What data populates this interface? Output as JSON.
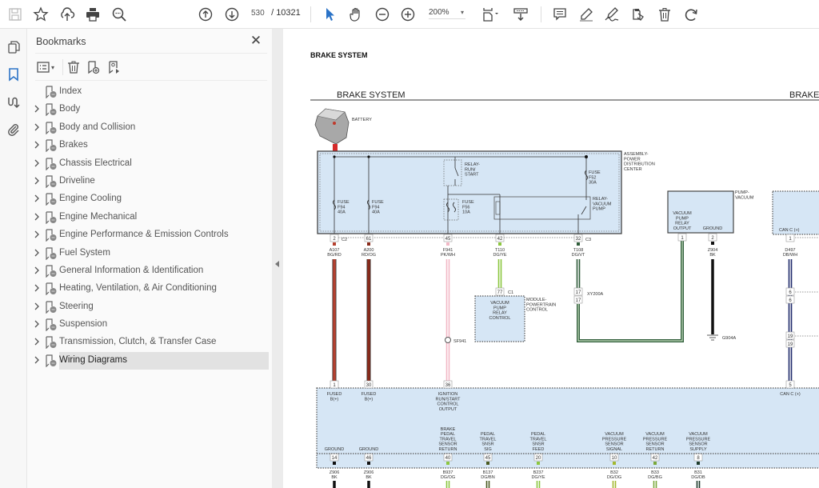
{
  "toolbar": {
    "buttons": [
      {
        "name": "save-icon",
        "label": "Save"
      },
      {
        "name": "star-icon",
        "label": "Bookmark"
      },
      {
        "name": "cloud-upload-icon",
        "label": "Upload"
      },
      {
        "name": "print-icon",
        "label": "Print"
      },
      {
        "name": "zoom-out-magnifier-icon",
        "label": "Find"
      },
      {
        "name": "arrow-up-circle-icon",
        "label": "Previous page"
      },
      {
        "name": "arrow-down-circle-icon",
        "label": "Next page"
      }
    ],
    "page_current": "530",
    "page_separator": "/",
    "page_total": "10321",
    "zoom_value": "200%",
    "tools": [
      "select-cursor-icon",
      "hand-icon",
      "zoom-out-icon",
      "zoom-in-icon",
      "fit-page-icon",
      "scroll-mode-icon",
      "comment-icon",
      "highlight-pen-icon",
      "sign-icon",
      "stamp-icon",
      "delete-icon",
      "rotate-icon"
    ]
  },
  "rail": {
    "items": [
      "pages-icon",
      "bookmark-icon",
      "articles-icon",
      "attachment-icon"
    ],
    "active": "bookmark-icon",
    "active_color": "#2b73c7"
  },
  "bookmarks": {
    "title": "Bookmarks",
    "items": [
      {
        "label": "Index",
        "expandable": false
      },
      {
        "label": "Body",
        "expandable": true
      },
      {
        "label": "Body and Collision",
        "expandable": true
      },
      {
        "label": "Brakes",
        "expandable": true
      },
      {
        "label": "Chassis Electrical",
        "expandable": true
      },
      {
        "label": "Driveline",
        "expandable": true
      },
      {
        "label": "Engine Cooling",
        "expandable": true
      },
      {
        "label": "Engine Mechanical",
        "expandable": true
      },
      {
        "label": "Engine Performance & Emission Controls",
        "expandable": true
      },
      {
        "label": "Fuel System",
        "expandable": true
      },
      {
        "label": "General Information & Identification",
        "expandable": true
      },
      {
        "label": "Heating, Ventilation, & Air Conditioning",
        "expandable": true
      },
      {
        "label": "Steering",
        "expandable": true
      },
      {
        "label": "Suspension",
        "expandable": true
      },
      {
        "label": "Transmission, Clutch, & Transfer Case",
        "expandable": true
      },
      {
        "label": "Wiring Diagrams",
        "expandable": true,
        "selected": true
      }
    ]
  },
  "document": {
    "page_heading": "BRAKE SYSTEM",
    "diagram_title": "BRAKE SYSTEM",
    "diagram_title_right": "BRAKE",
    "battery_label": "BATTERY",
    "pdc_label": [
      "ASSEMBLY-",
      "POWER",
      "DISTRIBUTION",
      "CENTER"
    ],
    "fuses": [
      {
        "lines": [
          "FUSE",
          "F94",
          "40A"
        ]
      },
      {
        "lines": [
          "FUSE",
          "F94",
          "40A"
        ]
      },
      {
        "lines": [
          "FUSE",
          "F56",
          "10A"
        ]
      },
      {
        "lines": [
          "FUSE",
          "F52",
          "30A"
        ]
      }
    ],
    "relay_run_start": [
      "RELAY-",
      "RUN/",
      "START"
    ],
    "relay_vacuum_pump": [
      "RELAY-",
      "VACUUM",
      "PUMP"
    ],
    "pdc_pins": [
      {
        "pin": "2",
        "conn": "C2",
        "circuit": "A107",
        "color": "BG/RD"
      },
      {
        "pin": "61",
        "conn": "",
        "circuit": "A200",
        "color": "RD/OG"
      },
      {
        "pin": "45",
        "conn": "",
        "circuit": "F941",
        "color": "PK/WH"
      },
      {
        "pin": "42",
        "conn": "",
        "circuit": "T110",
        "color": "DG/YE"
      },
      {
        "pin": "32",
        "conn": "C3",
        "circuit": "T108",
        "color": "DG/VT"
      }
    ],
    "pcm": {
      "pin": "77",
      "conn": "C1",
      "box_label": [
        "VACUUM",
        "PUMP",
        "RELAY",
        "CONTROL"
      ],
      "name": [
        "MODULE-",
        "POWERTRAIN",
        "CONTROL"
      ]
    },
    "splice": "SF941",
    "inline_connector": {
      "pin_top": "17",
      "pin_bottom": "17",
      "name": "XY200A"
    },
    "pump": {
      "name": [
        "PUMP-",
        "VACUUM"
      ],
      "output_label": [
        "VACUUM",
        "PUMP",
        "RELAY",
        "OUTPUT"
      ],
      "ground_label": "GROUND",
      "pin1": "1",
      "pin2": "2",
      "ground_circuit": "Z904",
      "ground_color": "BK",
      "ground_point": "G904A"
    },
    "can": {
      "label_top": "CAN C (+)",
      "pin_top": "1",
      "circuit": "D497",
      "color": "DB/WH",
      "pins_mid": [
        "6",
        "6",
        "19",
        "19"
      ],
      "pin_bottom": "5",
      "label_bottom": "CAN C (+)"
    },
    "lower_module_pins_top": [
      {
        "pin": "1",
        "label": [
          "FUSED",
          "B(+)"
        ]
      },
      {
        "pin": "30",
        "label": [
          "FUSED",
          "B(+)"
        ]
      },
      {
        "pin": "36",
        "label": [
          "IGNITION",
          "RUN/START",
          "CONTROL",
          "OUTPUT"
        ]
      }
    ],
    "lower_module_pins_bottom": [
      {
        "label": [
          "GROUND"
        ],
        "pin": "14",
        "circuit": "Z906",
        "color": "BK"
      },
      {
        "label": [
          "GROUND"
        ],
        "pin": "46",
        "circuit": "Z906",
        "color": "BK"
      },
      {
        "label": [
          "BRAKE",
          "PEDAL",
          "TRAVEL",
          "SENSOR",
          "RETURN"
        ],
        "pin": "40",
        "circuit": "B937",
        "color": "DG/OG"
      },
      {
        "label": [
          "PEDAL",
          "TRAVEL",
          "SNSR",
          "SIG"
        ],
        "pin": "45",
        "circuit": "B137",
        "color": "DG/BN"
      },
      {
        "label": [
          "PEDAL",
          "TRAVEL",
          "SNSR",
          "FEED"
        ],
        "pin": "20",
        "circuit": "B237",
        "color": "DG/YE"
      },
      {
        "label": [
          "VACUUM",
          "PRESSURE",
          "SENSOR",
          "SIGNAL"
        ],
        "pin": "10",
        "circuit": "B32",
        "color": "DG/OG"
      },
      {
        "label": [
          "VACUUM",
          "PRESSURE",
          "SENSOR",
          "RETURN"
        ],
        "pin": "42",
        "circuit": "B33",
        "color": "DG/BG"
      },
      {
        "label": [
          "VACUUM",
          "PRESSURE",
          "SENSOR",
          "SUPPLY"
        ],
        "pin": "8",
        "circuit": "B31",
        "color": "DG/DB"
      }
    ],
    "colors": {
      "module_fill": "#d6e6f5",
      "wire_red": "#b5412f",
      "wire_darkred": "#8a2a1a",
      "wire_pink": "#f2b8c6",
      "wire_yellowgreen": "#8cc63f",
      "wire_darkgreen": "#2f5d3a",
      "wire_black": "#111111",
      "wire_navy": "#1f2a6b"
    }
  }
}
